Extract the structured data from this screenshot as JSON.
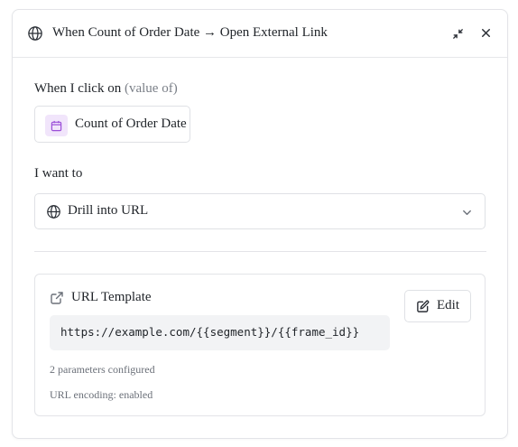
{
  "header": {
    "title": "When Count of Order Date → Open External Link",
    "icons": {
      "left": "globe-icon",
      "collapse": "collapse-icon",
      "close": "close-icon"
    }
  },
  "trigger": {
    "label": "When I click on",
    "label_muted": "(value of)",
    "column": {
      "icon": "calendar-icon",
      "name": "Count of Order Date"
    }
  },
  "action": {
    "label": "I want to",
    "selected": "Drill into URL",
    "icon": "globe-icon",
    "dropdown_icon": "chevron-down-icon"
  },
  "url_card": {
    "icon": "external-link-icon",
    "title": "URL Template",
    "template": "https://example.com/{{segment}}/{{frame_id}}",
    "params": "2 parameters configured",
    "encoding": "URL encoding: enabled",
    "edit_label": "Edit",
    "edit_icon": "edit-icon"
  },
  "colors": {
    "accent_purple": "#9b4fd8",
    "chip_bg": "#f1e5fb",
    "code_bg": "#f2f3f5",
    "border": "#e3e4e8",
    "muted_text": "#7a7f87"
  }
}
